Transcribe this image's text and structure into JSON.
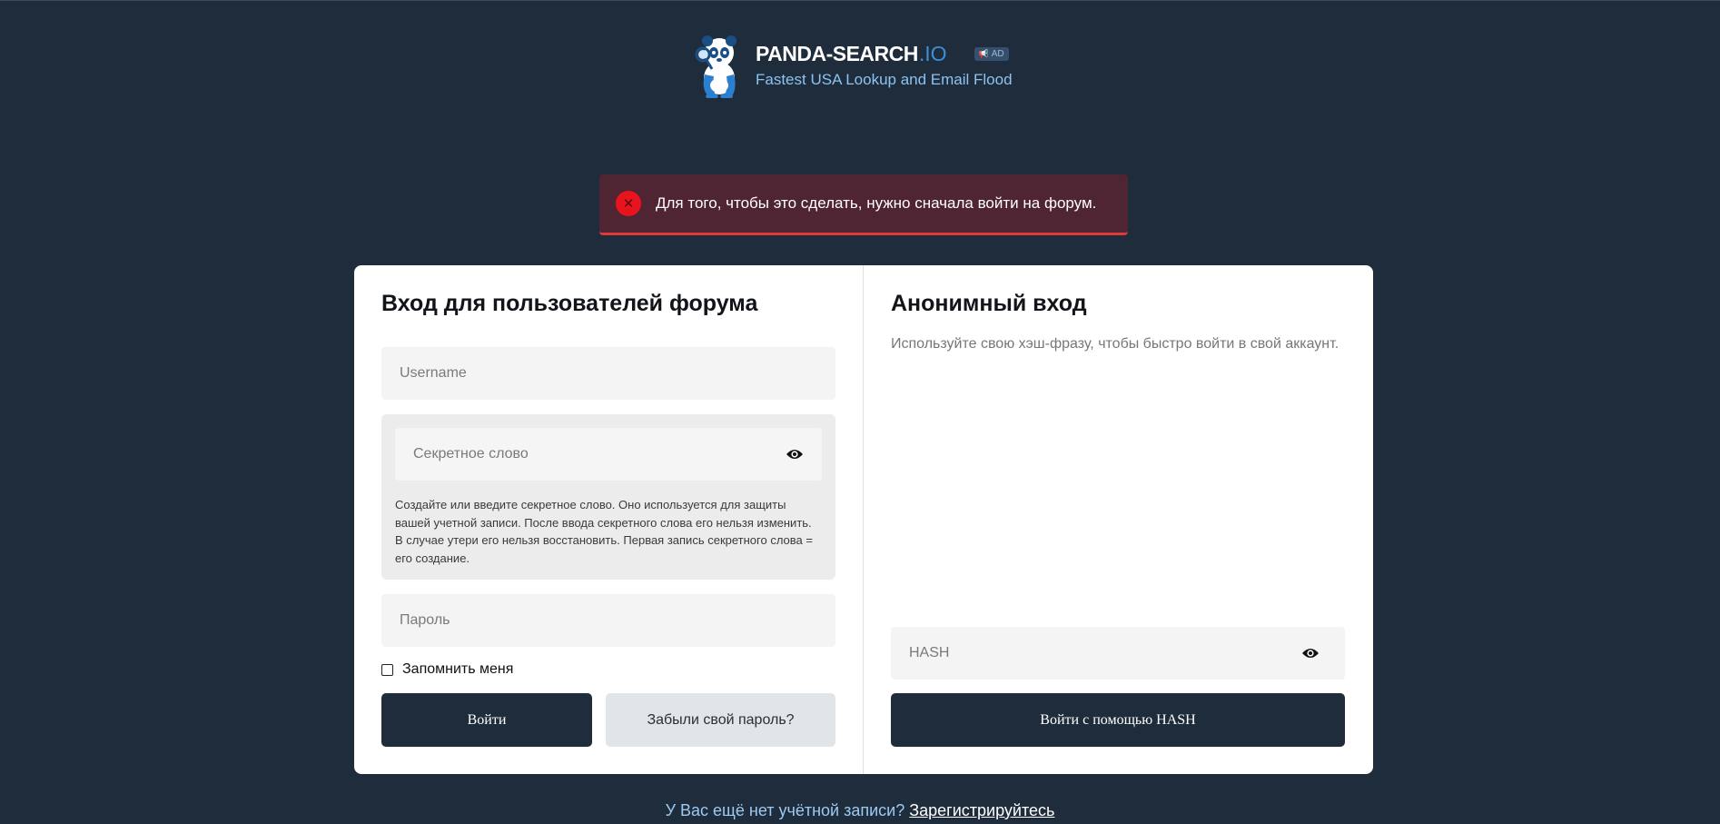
{
  "header": {
    "brand_name": "PANDA-SEARCH",
    "brand_tld": ".IO",
    "ad_badge": "AD",
    "tagline": "Fastest USA Lookup and Email Flood",
    "logo_icon": "panda-mascot-icon"
  },
  "alert": {
    "message": "Для того, чтобы это сделать, нужно сначала войти на форум.",
    "icon": "error-x-icon"
  },
  "forum_login": {
    "title": "Вход для пользователей форума",
    "username_placeholder": "Username",
    "username_value": "",
    "secret_placeholder": "Секретное слово",
    "secret_value": "",
    "secret_hint": "Создайте или введите секретное слово. Оно используется для защиты вашей учетной записи. После ввода секретного слова его нельзя изменить. В случае утери его нельзя восстановить. Первая запись секретного слова = его создание.",
    "password_placeholder": "Пароль",
    "password_value": "",
    "remember_label": "Запомнить меня",
    "remember_checked": false,
    "login_button": "Войти",
    "forgot_button": "Забыли свой пароль?"
  },
  "anon_login": {
    "title": "Анонимный вход",
    "subtitle": "Используйте свою хэш-фразу, чтобы быстро войти в свой аккаунт.",
    "hash_placeholder": "HASH",
    "hash_value": "",
    "hash_button": "Войти с помощью HASH"
  },
  "footer": {
    "prompt": "У Вас ещё нет учётной записи?",
    "register_link": "Зарегистрируйтесь"
  },
  "colors": {
    "background": "#1f2c3b",
    "accent": "#3b8fd9",
    "alert_bg": "#4f2433",
    "alert_icon": "#e8141d",
    "button_dark": "#1f2c3b",
    "button_light": "#e1e4e8"
  }
}
